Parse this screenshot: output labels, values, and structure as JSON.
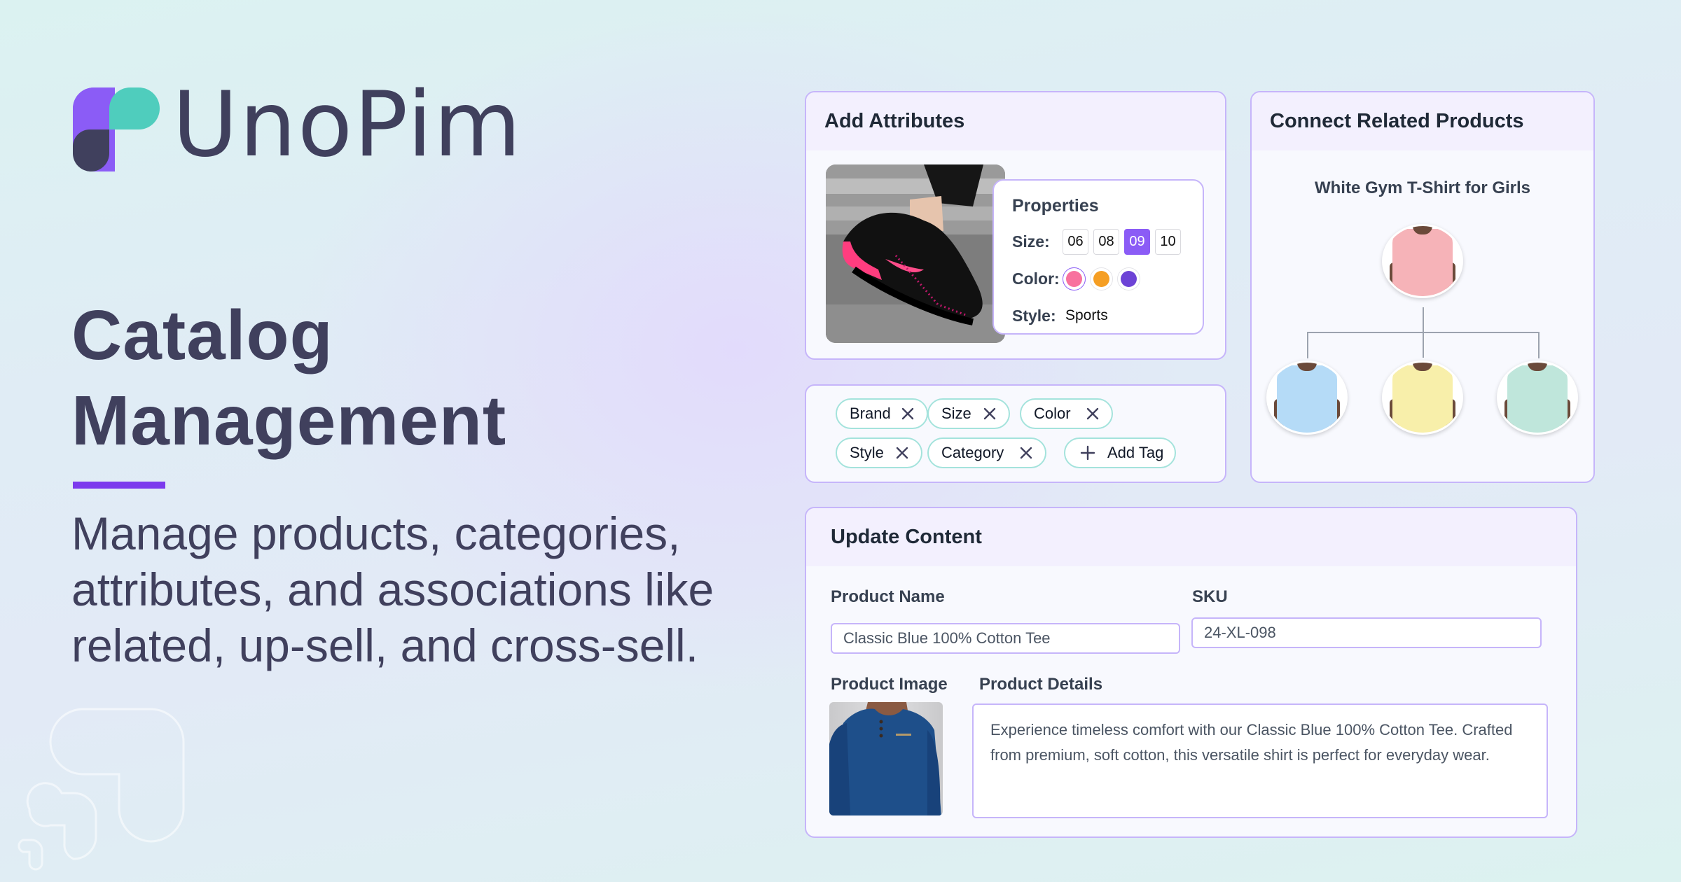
{
  "brand": {
    "name": "UnoPim",
    "colors": {
      "purple": "#8b5cf6",
      "teal": "#4fcdbd",
      "dark": "#40405d",
      "accent_bar": "#7c3aed"
    }
  },
  "hero": {
    "title_line1": "Catalog",
    "title_line2": "Management",
    "subtitle": "Manage products, categories, attributes, and associations like related, up-sell, and cross-sell."
  },
  "add_attributes": {
    "title": "Add Attributes",
    "image_alt": "Black and pink running sneaker",
    "properties": {
      "title": "Properties",
      "size_label": "Size:",
      "sizes": [
        {
          "value": "06",
          "selected": false
        },
        {
          "value": "08",
          "selected": false
        },
        {
          "value": "09",
          "selected": true
        },
        {
          "value": "10",
          "selected": false
        }
      ],
      "color_label": "Color:",
      "colors": [
        {
          "name": "pink",
          "hex": "#f8719e",
          "selected": true
        },
        {
          "name": "orange",
          "hex": "#f59e23",
          "selected": false
        },
        {
          "name": "purple",
          "hex": "#6d43d6",
          "selected": false
        }
      ],
      "style_label": "Style:",
      "style_value": "Sports"
    }
  },
  "tags": {
    "items": [
      "Brand",
      "Size",
      "Color",
      "Style",
      "Category"
    ],
    "add_label": "Add Tag"
  },
  "related_products": {
    "title": "Connect Related Products",
    "product_name": "White Gym T-Shirt for Girls",
    "parent": {
      "color_name": "pink",
      "hex": "#f6b3b8"
    },
    "children": [
      {
        "color_name": "blue",
        "hex": "#b5dbf7"
      },
      {
        "color_name": "yellow",
        "hex": "#f8efaa"
      },
      {
        "color_name": "mint",
        "hex": "#bfe6db"
      }
    ]
  },
  "update_content": {
    "title": "Update Content",
    "product_name_label": "Product Name",
    "product_name_value": "Classic Blue 100% Cotton Tee",
    "sku_label": "SKU",
    "sku_value": "24-XL-098",
    "product_image_label": "Product Image",
    "product_details_label": "Product Details",
    "product_details_value": "Experience timeless comfort with our Classic Blue 100% Cotton Tee. Crafted from premium, soft cotton, this versatile shirt is perfect for everyday wear."
  }
}
